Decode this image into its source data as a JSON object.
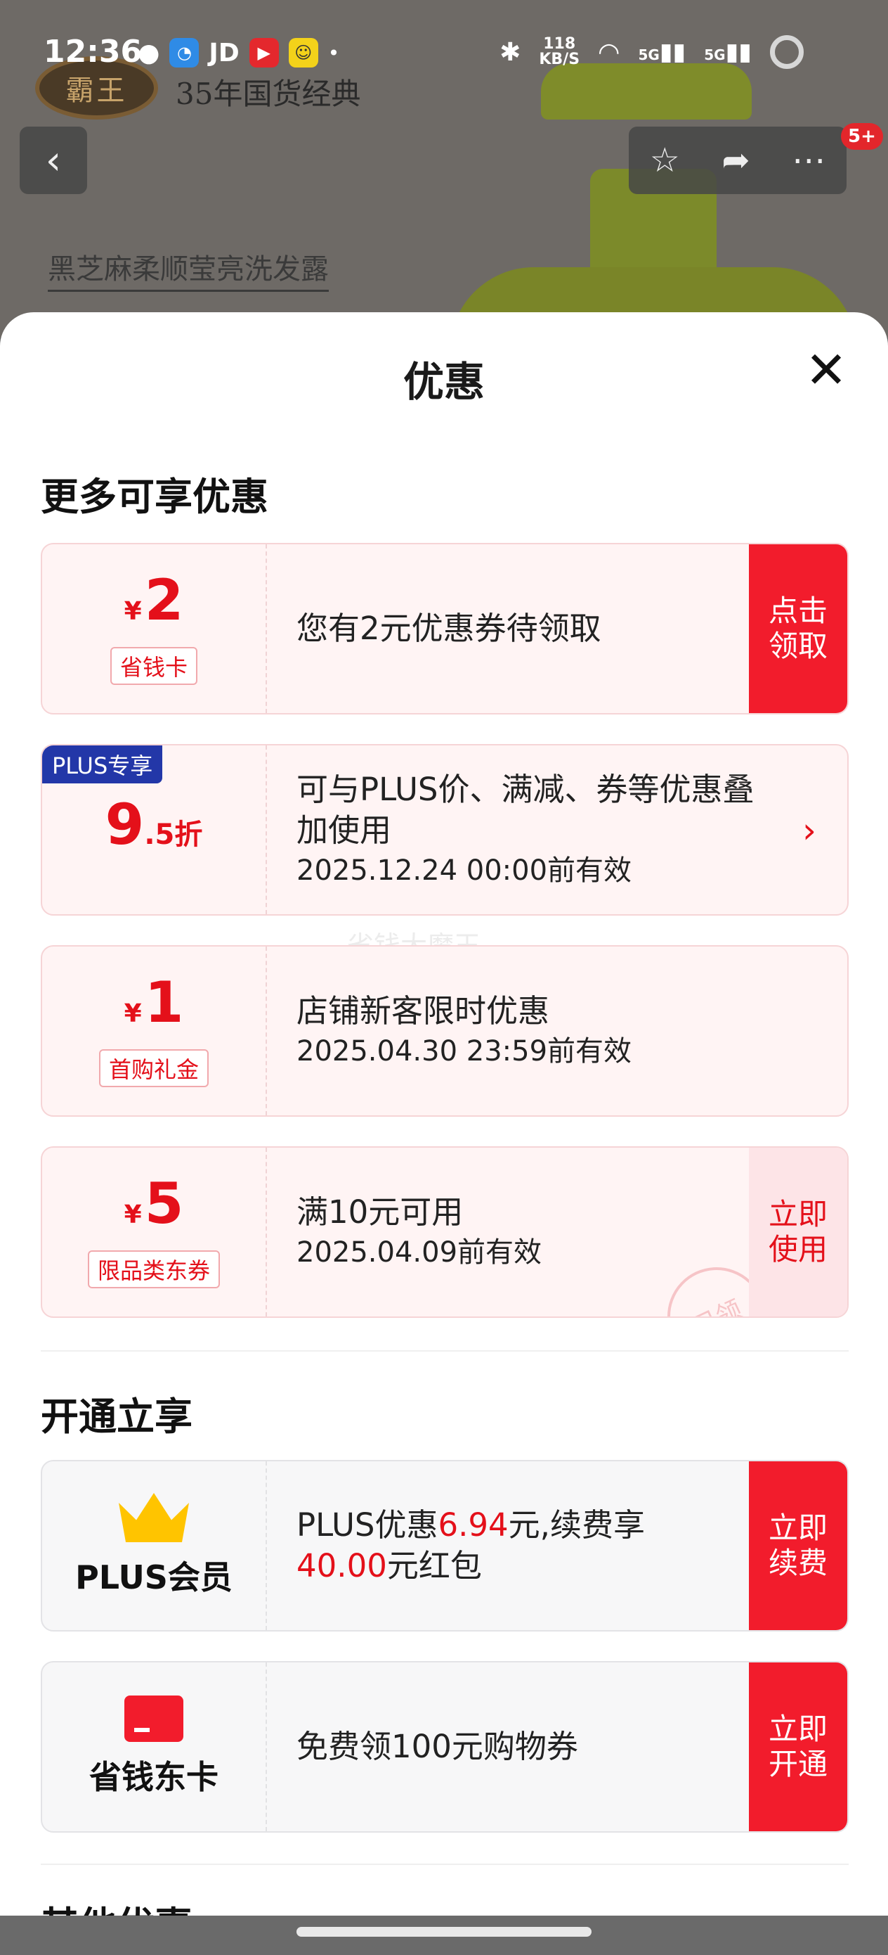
{
  "status_bar": {
    "time": "12:36",
    "apps": [
      "JD"
    ],
    "net_speed": "118",
    "net_unit": "KB/S",
    "signal1": "5G",
    "signal2": "5G"
  },
  "background_page": {
    "brand_logo": "霸王",
    "slogan": "35年国货经典",
    "product_name": "黑芝麻柔顺莹亮洗发露",
    "badge": "5+"
  },
  "sheet": {
    "title": "优惠",
    "section1": "更多可享优惠",
    "section2": "开通立享",
    "section3": "其他优惠",
    "watermark": "省钱大魔王"
  },
  "coupons": [
    {
      "currency": "¥",
      "amount": "2",
      "tag": "省钱卡",
      "main": "您有2元优惠券待领取",
      "action": "点击领取"
    },
    {
      "plus_tag": "PLUS专享",
      "amount": "9",
      "amount_small": ".5折",
      "main": "可与PLUS价、满减、券等优惠叠加使用",
      "sub": "2025.12.24 00:00前有效"
    },
    {
      "currency": "¥",
      "amount": "1",
      "tag": "首购礼金",
      "main": "店铺新客限时优惠",
      "sub": "2025.04.30 23:59前有效"
    },
    {
      "currency": "¥",
      "amount": "5",
      "tag": "限品类东券",
      "main": "满10元可用",
      "sub": "2025.04.09前有效",
      "action": "立即使用",
      "stamp": "已领"
    }
  ],
  "memberships": [
    {
      "name": "PLUS会员",
      "icon": "crown-icon",
      "text_prefix": "PLUS优惠",
      "value1": "6.94",
      "text_mid": "元,续费享",
      "value2": "40.00",
      "text_suffix": "元红包",
      "action": "立即续费"
    },
    {
      "name": "省钱东卡",
      "icon": "card-icon",
      "text": "免费领100元购物券",
      "action": "立即开通"
    }
  ],
  "colors": {
    "accent": "#f21c2c",
    "price_red": "#e4101a",
    "plus_blue": "#2337a8"
  }
}
